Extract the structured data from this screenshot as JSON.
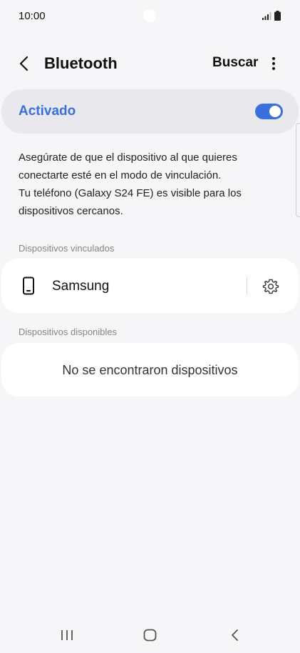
{
  "status_bar": {
    "time": "10:00",
    "icons": [
      "camera-dot",
      "signal-icon",
      "battery-icon"
    ]
  },
  "header": {
    "title": "Bluetooth",
    "search_label": "Buscar",
    "icons": [
      "back-icon",
      "more-icon"
    ]
  },
  "toggle": {
    "label": "Activado",
    "state": "on",
    "accent_color": "#3b6fdc"
  },
  "info": {
    "lines": [
      "Asegúrate de que el dispositivo al que quieres",
      "conectarte esté en el modo de vinculación.",
      "Tu teléfono (Galaxy S24 FE) es visible para los",
      "dispositivos cercanos."
    ]
  },
  "paired": {
    "section_label": "Dispositivos vinculados",
    "devices": [
      {
        "name": "Samsung",
        "icon": "phone-icon",
        "action_icon": "gear-icon"
      }
    ]
  },
  "available": {
    "section_label": "Dispositivos disponibles",
    "empty_message": "No se encontraron dispositivos"
  },
  "nav_bar": {
    "icons": [
      "recents-icon",
      "home-icon",
      "back-icon"
    ]
  }
}
